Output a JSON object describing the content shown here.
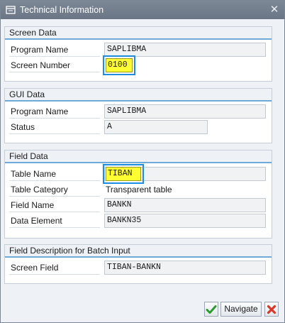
{
  "window": {
    "title": "Technical Information",
    "title_icon": "window-icon",
    "close_icon": "close-icon",
    "close_glyph": "✕"
  },
  "screen_data": {
    "header": "Screen Data",
    "program_name_label": "Program Name",
    "program_name_value": "SAPLIBMA",
    "screen_number_label": "Screen Number",
    "screen_number_value": "0100"
  },
  "gui_data": {
    "header": "GUI Data",
    "program_name_label": "Program Name",
    "program_name_value": "SAPLIBMA",
    "status_label": "Status",
    "status_value": "A"
  },
  "field_data": {
    "header": "Field Data",
    "table_name_label": "Table Name",
    "table_name_value": "TIBAN",
    "table_category_label": "Table Category",
    "table_category_value": "Transparent table",
    "field_name_label": "Field Name",
    "field_name_value": "BANKN",
    "data_element_label": "Data Element",
    "data_element_value": "BANKN35"
  },
  "batch_input": {
    "header": "Field Description for Batch Input",
    "screen_field_label": "Screen Field",
    "screen_field_value": "TIBAN-BANKN"
  },
  "footer": {
    "confirm_icon": "checkmark-icon",
    "navigate_label": "Navigate",
    "cancel_icon": "cancel-icon"
  },
  "colors": {
    "highlight": "#ffff33",
    "highlight_border": "#1f8ce0",
    "titlebar": "#717c8c",
    "section_rule": "#6fa9d8"
  }
}
